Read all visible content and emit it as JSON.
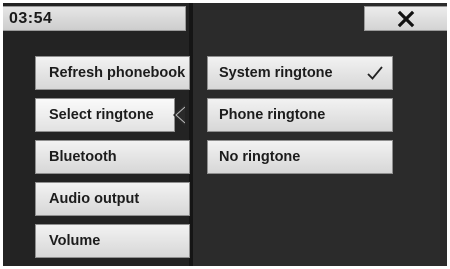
{
  "status_bar": {
    "time": "03:54"
  },
  "close_icon": "close-x-icon",
  "menu": {
    "items": [
      {
        "label": "Refresh phonebook"
      },
      {
        "label": "Select ringtone"
      },
      {
        "label": "Bluetooth"
      },
      {
        "label": "Audio output"
      },
      {
        "label": "Volume"
      }
    ],
    "selected_index": 1
  },
  "submenu": {
    "items": [
      {
        "label": "System ringtone",
        "checked": true
      },
      {
        "label": "Phone ringtone",
        "checked": false
      },
      {
        "label": "No ringtone",
        "checked": false
      }
    ],
    "check_icon": "checkmark-icon"
  }
}
